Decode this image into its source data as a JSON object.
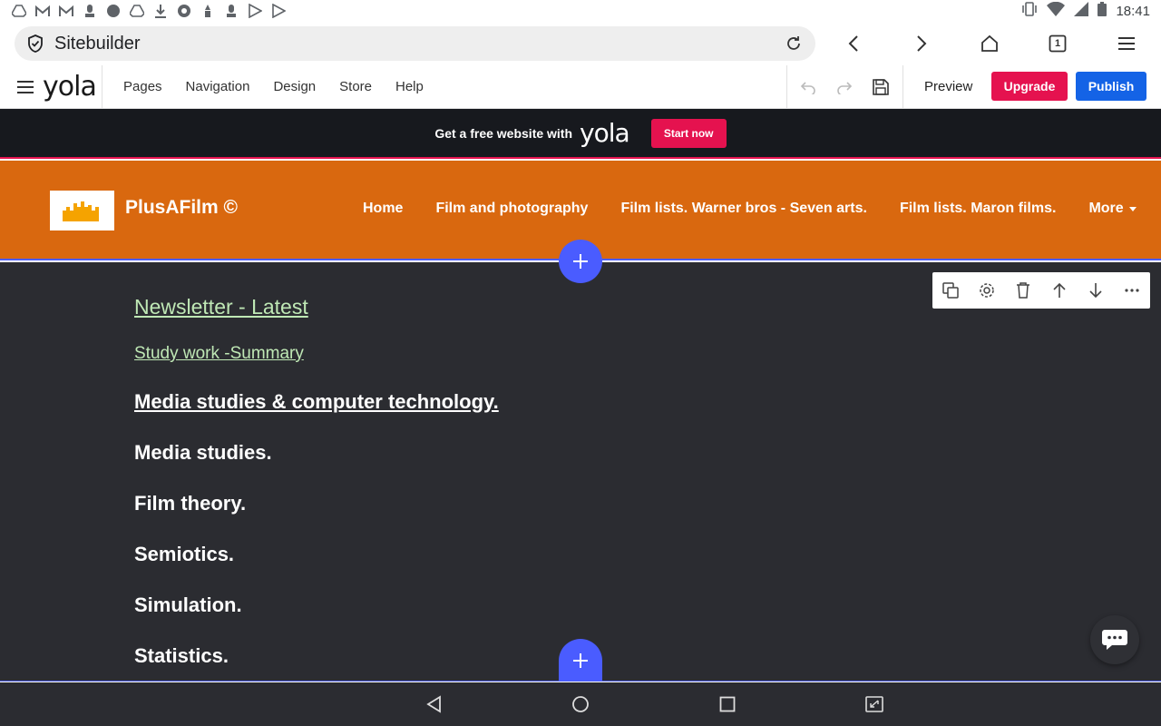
{
  "status_bar": {
    "time": "18:41",
    "left_icons": [
      "drive-icon",
      "gmail-icon",
      "gmail-icon",
      "chess-icon",
      "android-icon",
      "drive-icon",
      "download-icon",
      "aperture-icon",
      "chess-icon",
      "chess-icon",
      "play-icon",
      "play-icon"
    ],
    "right_icons": [
      "vibrate-icon",
      "wifi-icon",
      "signal-icon",
      "battery-icon"
    ]
  },
  "browser": {
    "url": "Sitebuilder",
    "tab_count": "1"
  },
  "editor": {
    "logo": "yola",
    "menu": [
      "Pages",
      "Navigation",
      "Design",
      "Store",
      "Help"
    ],
    "preview_label": "Preview",
    "upgrade_label": "Upgrade",
    "publish_label": "Publish"
  },
  "promo": {
    "text": "Get a free website with",
    "logo": "yola",
    "button_label": "Start now"
  },
  "site": {
    "title": "PlusAFilm ©",
    "nav": [
      "Home",
      "Film and photography",
      "Film lists. Warner bros - Seven arts.",
      "Film lists. Maron films.",
      "More"
    ]
  },
  "content": {
    "newsletter_link": "Newsletter - Latest",
    "study_link": "Study work -Summary",
    "media_link": "Media studies & computer technology.",
    "items": [
      "Media studies.",
      "Film theory.",
      "Semiotics.",
      "Simulation.",
      "Statistics."
    ]
  },
  "colors": {
    "site_header": "#d9680f",
    "content_bg": "#2b2c31",
    "accent_blue": "#4a5cff",
    "upgrade": "#e5124f",
    "publish": "#1463e6",
    "link_green": "#bfe8b5"
  }
}
